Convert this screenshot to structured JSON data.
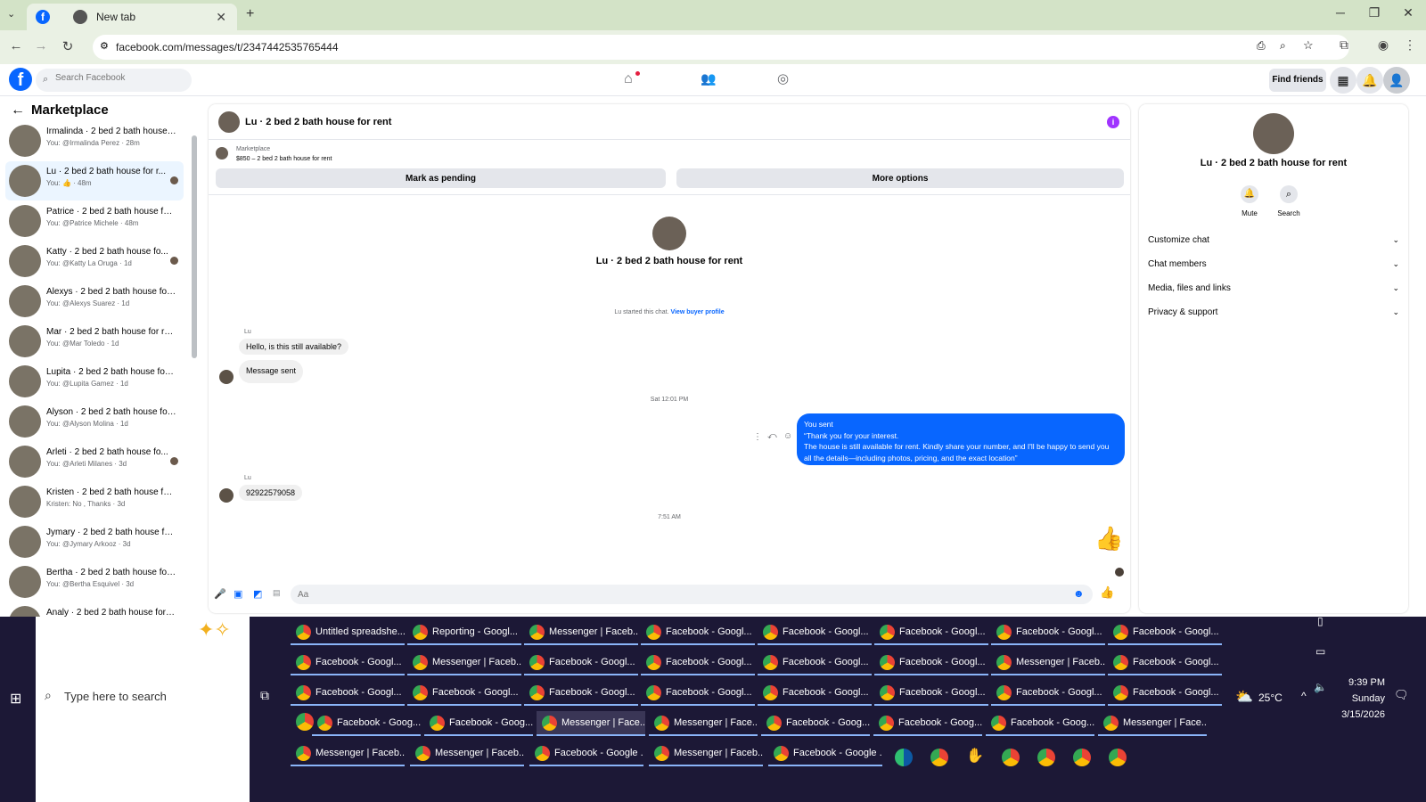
{
  "browser": {
    "tabs": [
      {
        "label": "",
        "active": true
      },
      {
        "label": "New tab",
        "active": false
      }
    ],
    "url": "facebook.com/messages/t/2347442535765444"
  },
  "fb": {
    "search_placeholder": "Search Facebook",
    "find_friends": "Find friends"
  },
  "sidebar": {
    "title": "Marketplace",
    "conversations": [
      {
        "title": "Irmalinda · 2 bed 2 bath house ...",
        "sub": "You: @Irmalinda Perez · 28m",
        "dot": false,
        "selected": false
      },
      {
        "title": "Lu · 2 bed 2 bath house for r...",
        "sub": "You: 👍 · 48m",
        "dot": true,
        "selected": true
      },
      {
        "title": "Patrice · 2 bed 2 bath house for...",
        "sub": "You: @Patrice Michele · 48m",
        "dot": false,
        "selected": false
      },
      {
        "title": "Katty · 2 bed 2 bath house fo...",
        "sub": "You: @Katty La Oruga · 1d",
        "dot": true,
        "selected": false
      },
      {
        "title": "Alexys · 2 bed 2 bath house for ...",
        "sub": "You: @Alexys Suarez · 1d",
        "dot": false,
        "selected": false
      },
      {
        "title": "Mar · 2 bed 2 bath house for rent",
        "sub": "You: @Mar Toledo · 1d",
        "dot": false,
        "selected": false
      },
      {
        "title": "Lupita · 2 bed 2 bath house for ...",
        "sub": "You: @Lupita Gamez · 1d",
        "dot": false,
        "selected": false
      },
      {
        "title": "Alyson · 2 bed 2 bath house for...",
        "sub": "You: @Alyson Molina · 1d",
        "dot": false,
        "selected": false
      },
      {
        "title": "Arleti · 2 bed 2 bath house fo...",
        "sub": "You: @Arleti Milanes · 3d",
        "dot": true,
        "selected": false
      },
      {
        "title": "Kristen · 2 bed 2 bath house for...",
        "sub": "Kristen: No , Thanks · 3d",
        "dot": false,
        "selected": false
      },
      {
        "title": "Jymary · 2 bed 2 bath house for...",
        "sub": "You: @Jymary Arkooz · 3d",
        "dot": false,
        "selected": false
      },
      {
        "title": "Bertha · 2 bed 2 bath house for ...",
        "sub": "You: @Bertha Esquivel · 3d",
        "dot": false,
        "selected": false
      },
      {
        "title": "Analy · 2 bed 2 bath house for r...",
        "sub": "",
        "dot": false,
        "selected": false
      }
    ]
  },
  "chat": {
    "header_title": "Lu · 2 bed 2 bath house for rent",
    "listing_label": "Marketplace",
    "listing_detail": "$850 – 2 bed 2 bath house for rent",
    "mark_pending": "Mark as pending",
    "more_options": "More options",
    "center_title": "Lu · 2 bed 2 bath house for rent",
    "started_text": "Lu started this chat.",
    "view_profile": "View buyer profile",
    "sender1": "Lu",
    "msg1": "Hello, is this still available?",
    "msg2": "Message sent",
    "timestamp1": "Sat 12:01 PM",
    "you_sent": "You sent",
    "out_line1": "“Thank you for your interest.",
    "out_line2": "The house is still available for rent. Kindly share your number, and I'll be happy to send you all the details—including photos, pricing, and the exact location”",
    "sender2": "Lu",
    "msg3": "92922579058",
    "timestamp2": "7:51 AM",
    "composer_placeholder": "Aa"
  },
  "info": {
    "title": "Lu · 2 bed 2 bath house for rent",
    "mute": "Mute",
    "search": "Search",
    "sections": [
      "Customize chat",
      "Chat members",
      "Media, files and links",
      "Privacy & support"
    ]
  },
  "taskbar": {
    "search_placeholder": "Type here to search",
    "rows": [
      [
        "Untitled spreadshe...",
        "Reporting - Googl...",
        "Messenger | Faceb...",
        "Facebook - Googl...",
        "Facebook - Googl...",
        "Facebook - Googl...",
        "Facebook - Googl...",
        "Facebook - Googl..."
      ],
      [
        "Facebook - Googl...",
        "Messenger | Faceb...",
        "Facebook - Googl...",
        "Facebook - Googl...",
        "Facebook - Googl...",
        "Facebook - Googl...",
        "Messenger | Faceb...",
        "Facebook - Googl..."
      ],
      [
        "Facebook - Googl...",
        "Facebook - Googl...",
        "Facebook - Googl...",
        "Facebook - Googl...",
        "Facebook - Googl...",
        "Facebook - Googl...",
        "Facebook - Googl...",
        "Facebook - Googl..."
      ],
      [
        "Facebook - Goog...",
        "Facebook - Goog...",
        "Messenger | Face...",
        "Messenger | Face...",
        "Facebook - Goog...",
        "Facebook - Goog...",
        "Facebook - Goog...",
        "Messenger | Face..."
      ],
      [
        "Messenger | Faceb...",
        "Messenger | Faceb...",
        "Facebook - Google ...",
        "Messenger | Faceb...",
        "Facebook - Google ..."
      ]
    ],
    "weather": "25°C",
    "time": "9:39 PM",
    "day": "Sunday",
    "date": "3/15/2026"
  },
  "colors": {
    "fb_blue": "#0866ff",
    "bubble_out": "#0866ff",
    "taskbar": "#1c1836",
    "tabstrip": "#d3e3c7"
  }
}
